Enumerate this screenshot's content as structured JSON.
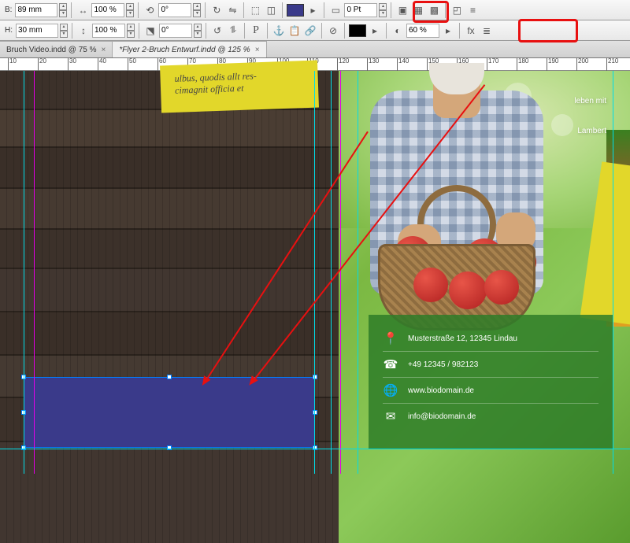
{
  "toolbar": {
    "width_label": "B:",
    "height_label": "H:",
    "width_value": "89 mm",
    "height_value": "30 mm",
    "scale_x": "100 %",
    "scale_y": "100 %",
    "rotation": "0°",
    "shear": "0°",
    "stroke_weight": "0 Pt",
    "opacity": "60 %",
    "fill_color": "#3a3a8a",
    "stroke_color": "#000000"
  },
  "tabs": [
    {
      "label": "Bruch Video.indd @ 75 %",
      "active": false
    },
    {
      "label": "*Flyer 2-Bruch Entwurf.indd @ 125 %",
      "active": true
    }
  ],
  "ruler_ticks": [
    "10",
    "20",
    "30",
    "40",
    "50",
    "60",
    "70",
    "80",
    "90",
    "100",
    "110",
    "120",
    "130",
    "140",
    "150",
    "160",
    "170",
    "180",
    "190",
    "200",
    "210"
  ],
  "flyer": {
    "yellow_text1": "ulbus, quodis allt res-",
    "yellow_text2": "cimagnit officia et",
    "script_line1": "leben mit",
    "script_line2": "Lambert"
  },
  "contact": {
    "address": "Musterstraße 12, 12345 Lindau",
    "phone": "+49 12345 / 982123",
    "web": "www.biodomain.de",
    "email": "info@biodomain.de"
  }
}
